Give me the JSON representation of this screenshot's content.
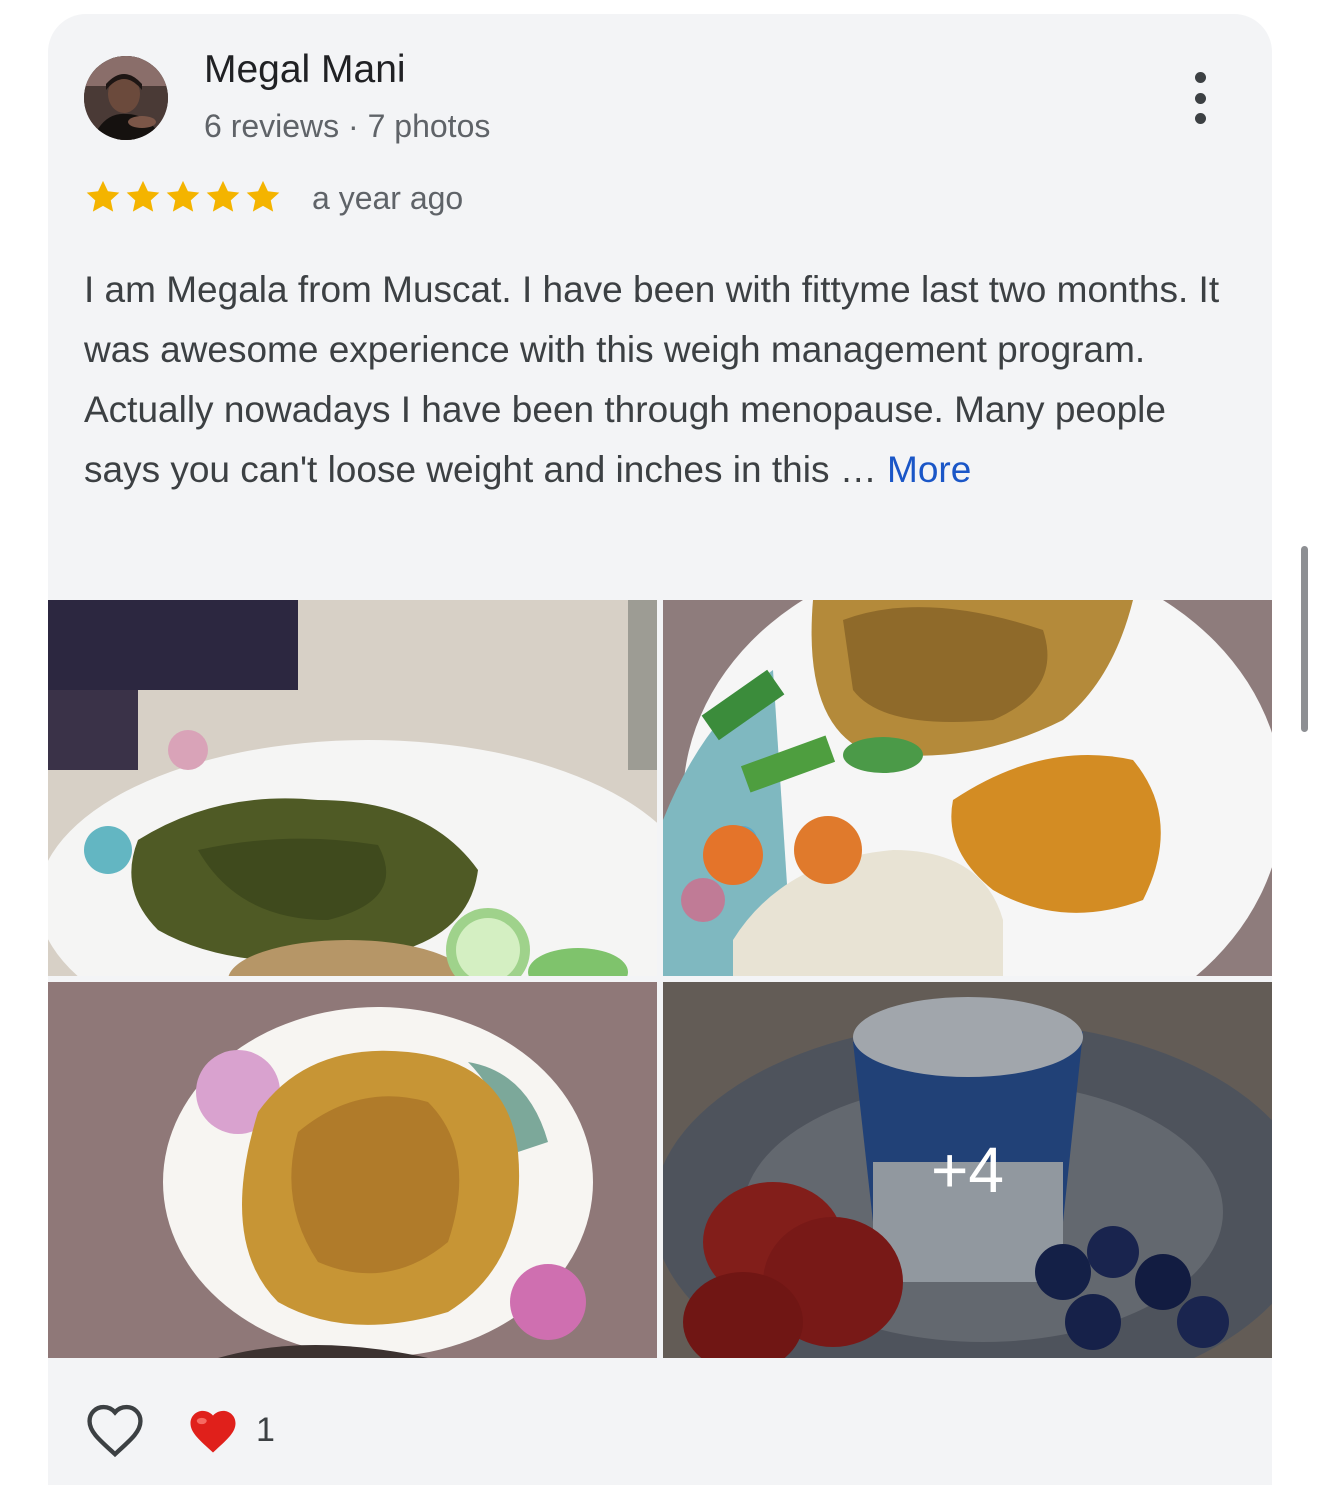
{
  "review": {
    "author": {
      "name": "Megal Mani",
      "meta": "6 reviews · 7 photos"
    },
    "rating": 5,
    "time": "a year ago",
    "text": "I am Megala from Muscat. I have been with fittyme last two months. It was awesome experience with this weigh management program. Actually nowadays I have been through menopause. Many people says you can't loose weight and inches in this … ",
    "more_label": "More",
    "photos": {
      "extra_count": "+4"
    },
    "reactions": {
      "heart_count": "1"
    }
  },
  "colors": {
    "star": "#f4b400",
    "link": "#1a56c7",
    "heart": "#e0201b"
  },
  "icons": {
    "options": "more-vert-icon",
    "like": "heart-outline-icon",
    "reaction": "red-heart-icon"
  }
}
